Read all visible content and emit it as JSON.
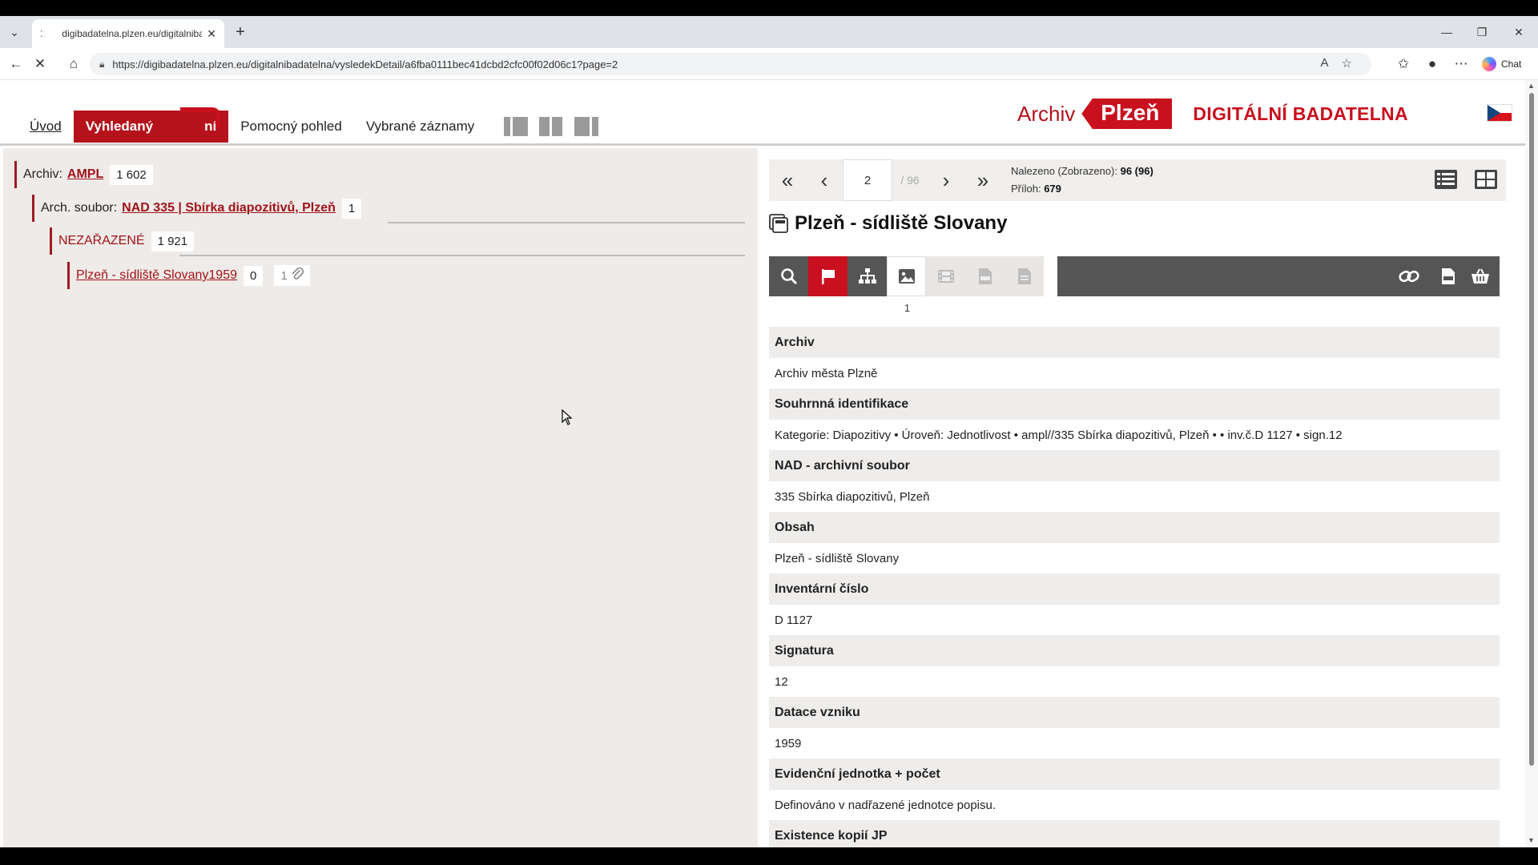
{
  "browser": {
    "tab_title": "digibadatelna.plzen.eu/digitalniba",
    "url": "https://digibadatelna.plzen.eu/digitalnibadatelna/vysledekDetail/a6fba0111bec41dcbd2cfc00f02d06c1?page=2",
    "chat_label": "Chat"
  },
  "menu": {
    "uvod": "Úvod",
    "vyhledavani": "Vyhledaný",
    "vyhledavani_tail": "ní",
    "pomocny": "Pomocný pohled",
    "vybrane": "Vybrané záznamy"
  },
  "brand": {
    "archiv": "Archiv",
    "plzen": "Plzeň",
    "title": "DIGITÁLNÍ BADATELNA"
  },
  "tree": {
    "archiv_label": "Archiv:",
    "archiv_link": "AMPL",
    "archiv_count": "1 602",
    "soubor_label": "Arch. soubor:",
    "soubor_link": "NAD 335 | Sbírka diapozitivů, Plzeň",
    "soubor_count": "1",
    "nezarazene": "NEZAŘAZENÉ",
    "nezarazene_count": "1 921",
    "item_link": "Plzeň - sídliště Slovany1959",
    "item_count": "0",
    "item_attach": "1"
  },
  "pager": {
    "page": "2",
    "total": "/ 96",
    "found_label": "Nalezeno (Zobrazeno):",
    "found_value": "96 (96)",
    "attach_label": "Příloh:",
    "attach_value": "679"
  },
  "detail": {
    "title": "Plzeň - sídliště Slovany",
    "image_count": "1",
    "fields": [
      {
        "label": "Archiv",
        "value": "Archiv města Plzně"
      },
      {
        "label": "Souhrnná identifikace",
        "value": "Kategorie: Diapozitivy • Úroveň: Jednotlivost • ampl//335 Sbírka diapozitivů, Plzeň • • inv.č.D 1127 • sign.12"
      },
      {
        "label": "NAD - archivní soubor",
        "value": "335 Sbírka diapozitivů, Plzeň"
      },
      {
        "label": "Obsah",
        "value": "Plzeň - sídliště Slovany"
      },
      {
        "label": "Inventární číslo",
        "value": "D 1127"
      },
      {
        "label": "Signatura",
        "value": "12"
      },
      {
        "label": "Datace vzniku",
        "value": "1959"
      },
      {
        "label": "Evidenční jednotka + počet",
        "value": "Definováno v nadřazené jednotce popisu."
      },
      {
        "label": "Existence kopií JP",
        "value": ""
      }
    ]
  },
  "colors": {
    "brand_red": "#c8101e",
    "dark_toolbar": "#555555",
    "tree_bg": "#eeebe8"
  }
}
